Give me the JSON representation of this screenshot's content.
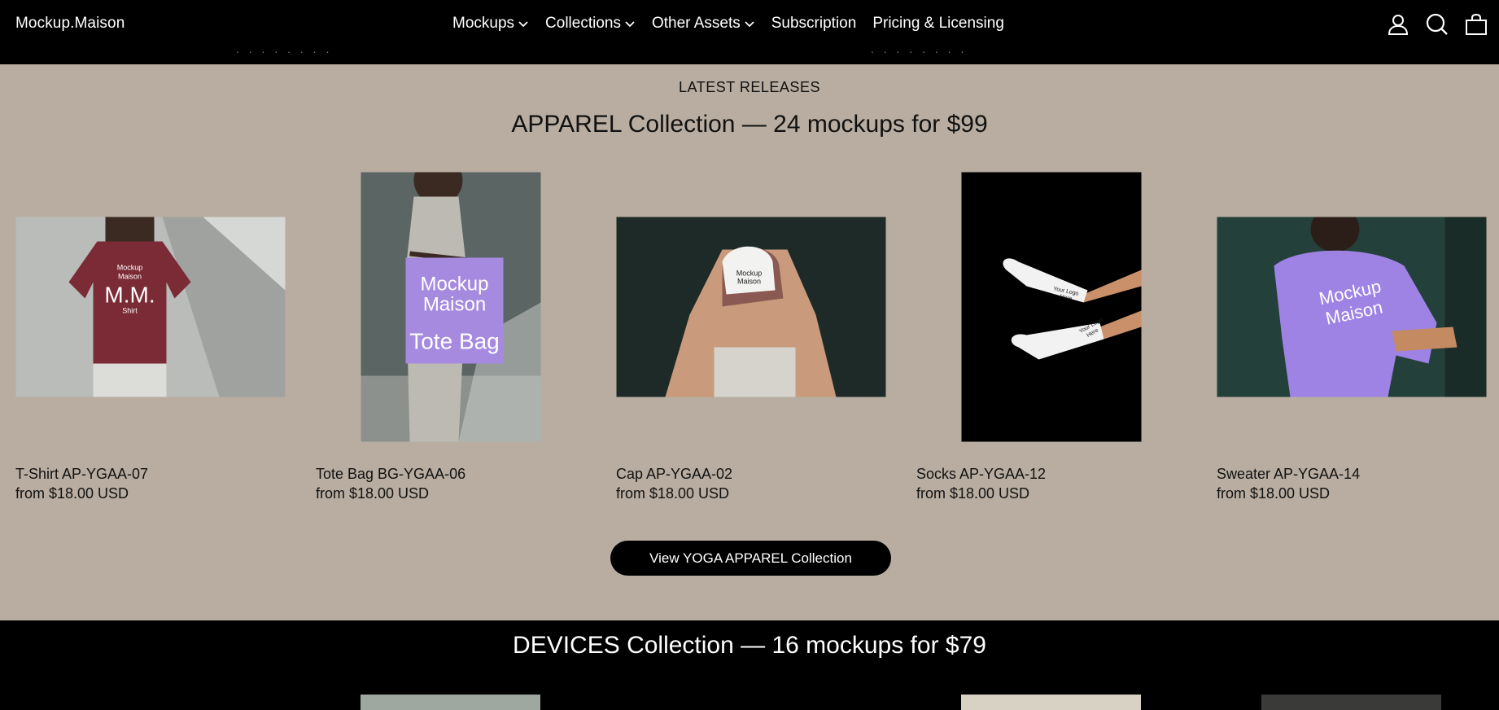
{
  "header": {
    "logo": "Mockup.Maison",
    "nav": [
      {
        "label": "Mockups",
        "dropdown": true
      },
      {
        "label": "Collections",
        "dropdown": true
      },
      {
        "label": "Other Assets",
        "dropdown": true
      },
      {
        "label": "Subscription",
        "dropdown": false
      },
      {
        "label": "Pricing & Licensing",
        "dropdown": false
      }
    ],
    "icons": [
      "account-icon",
      "search-icon",
      "cart-icon"
    ]
  },
  "apparel": {
    "eyebrow": "LATEST RELEASES",
    "title": "APPAREL Collection — 24 mockups for $99",
    "products": [
      {
        "name": "T-Shirt AP-YGAA-07",
        "price": "from $18.00 USD",
        "orientation": "landscape",
        "image_text": [
          "Mockup",
          "Maison",
          "M.M.",
          "Shirt"
        ],
        "item_color": "#7a2b35",
        "bg_color": "#b9bcb9"
      },
      {
        "name": "Tote Bag BG-YGAA-06",
        "price": "from $18.00 USD",
        "orientation": "portrait",
        "image_text": [
          "Mockup",
          "Maison",
          "Tote Bag"
        ],
        "item_color": "#a68ae0",
        "bg_color": "#5b6563"
      },
      {
        "name": "Cap AP-YGAA-02",
        "price": "from $18.00 USD",
        "orientation": "landscape",
        "image_text": [
          "Mockup",
          "Maison"
        ],
        "item_color": "#8a5a52",
        "bg_color": "#1e2a28"
      },
      {
        "name": "Socks AP-YGAA-12",
        "price": "from $18.00 USD",
        "orientation": "portrait",
        "image_text": [
          "Your Logo",
          "Here",
          "Your Logo",
          "Here"
        ],
        "item_color": "#f2f2f2",
        "bg_color": "#000000"
      },
      {
        "name": "Sweater AP-YGAA-14",
        "price": "from $18.00 USD",
        "orientation": "landscape",
        "image_text": [
          "Mockup",
          "Maison"
        ],
        "item_color": "#9e82e4",
        "bg_color": "#24403a"
      }
    ],
    "cta_label": "View YOGA APPAREL Collection"
  },
  "devices": {
    "title": "DEVICES Collection — 16 mockups for $79"
  }
}
